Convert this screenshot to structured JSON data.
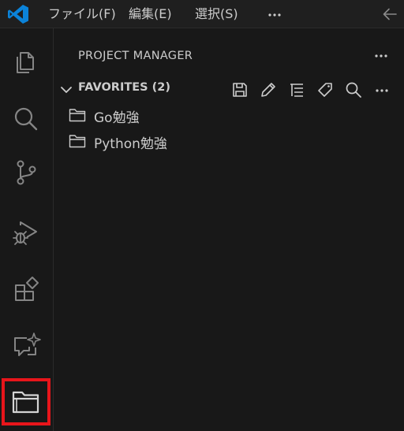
{
  "titlebar": {
    "app_icon": "vscode-logo-icon",
    "menus": [
      "ファイル(F)",
      "編集(E)",
      "選択(S)"
    ],
    "more_icon": "ellipsis-icon",
    "back_icon": "arrow-left-icon"
  },
  "activitybar": {
    "items": [
      {
        "name": "explorer",
        "icon": "files-icon"
      },
      {
        "name": "search",
        "icon": "search-icon"
      },
      {
        "name": "source-control",
        "icon": "source-control-icon"
      },
      {
        "name": "run-and-debug",
        "icon": "run-debug-icon"
      },
      {
        "name": "extensions",
        "icon": "extensions-icon"
      },
      {
        "name": "chat",
        "icon": "chat-sparkle-icon"
      },
      {
        "name": "project-manager",
        "icon": "folder-open-icon",
        "active": true
      }
    ],
    "highlight_color": "#e8151b"
  },
  "sidebar": {
    "title": "PROJECT MANAGER",
    "section": {
      "title": "FAVORITES (2)",
      "actions": [
        "save-icon",
        "pencil-icon",
        "filter-list-icon",
        "tag-icon",
        "search-icon",
        "ellipsis-icon"
      ]
    },
    "projects": [
      {
        "label": "Go勉強"
      },
      {
        "label": "Python勉強"
      }
    ]
  },
  "colors": {
    "background": "#181818",
    "titlebar": "#1f1f1f",
    "foreground": "#cccccc",
    "accent": "#0078d4"
  }
}
